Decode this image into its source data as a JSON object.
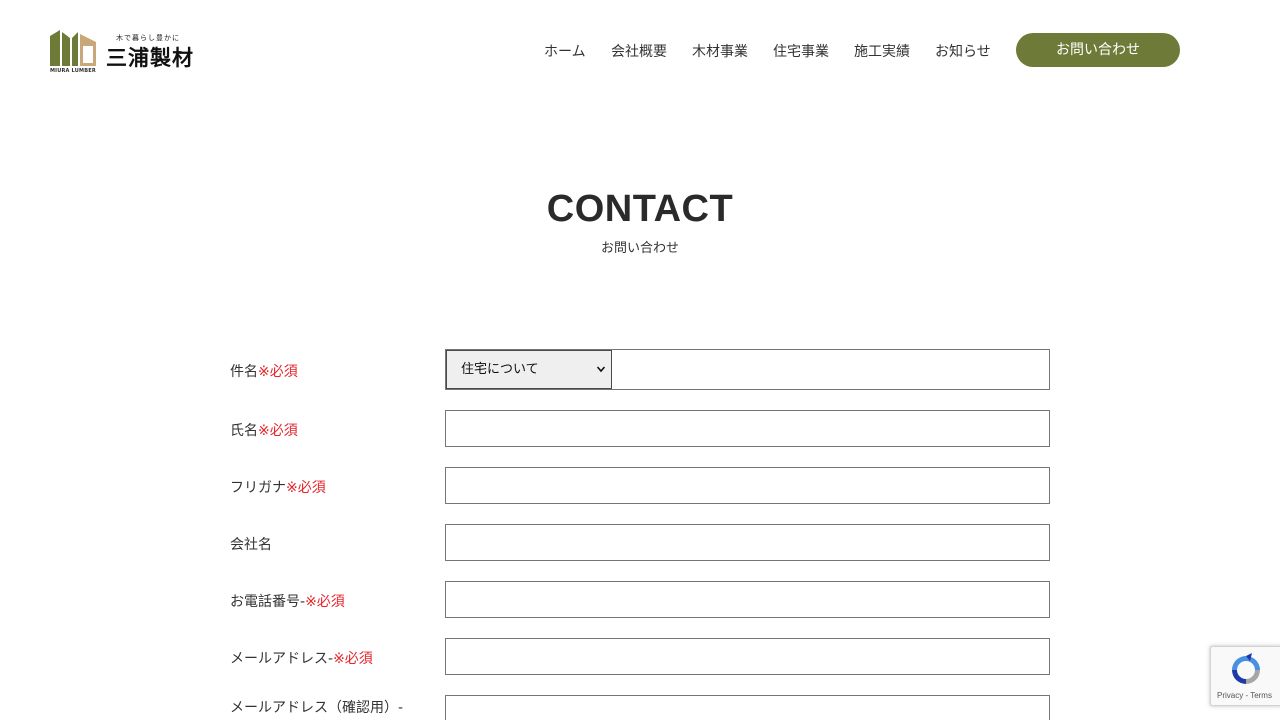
{
  "brand": {
    "tagline": "木で暮らし豊かに",
    "name": "三浦製材",
    "sub": "MIURA LUMBER",
    "accent_color": "#6d7a38"
  },
  "nav": {
    "items": [
      {
        "label": "ホーム"
      },
      {
        "label": "会社概要"
      },
      {
        "label": "木材事業"
      },
      {
        "label": "住宅事業"
      },
      {
        "label": "施工実績"
      },
      {
        "label": "お知らせ"
      }
    ],
    "cta_label": "お問い合わせ"
  },
  "page": {
    "title": "CONTACT",
    "subtitle": "お問い合わせ"
  },
  "form": {
    "required_mark": "※必須",
    "fields": [
      {
        "label": "件名",
        "required": true,
        "type": "select",
        "value": "住宅について"
      },
      {
        "label": "氏名",
        "required": true,
        "value": ""
      },
      {
        "label": "フリガナ",
        "required": true,
        "value": ""
      },
      {
        "label": "会社名",
        "required": false,
        "value": ""
      },
      {
        "label": "お電話番号-",
        "required": true,
        "value": ""
      },
      {
        "label": "メールアドレス-",
        "required": true,
        "value": ""
      },
      {
        "label": "メールアドレス（確認用）-",
        "required": false,
        "value": ""
      }
    ]
  },
  "recaptcha": {
    "links": "Privacy - Terms"
  }
}
